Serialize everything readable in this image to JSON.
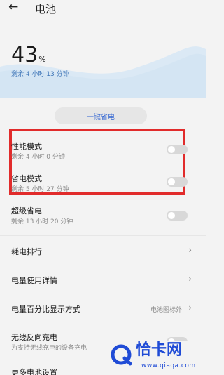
{
  "header": {
    "back_icon": "back-arrow-icon",
    "title": "电池"
  },
  "battery": {
    "percent": "43",
    "percent_sign": "%",
    "remaining": "剩余 4 小时 13 分钟",
    "level_fraction": 0.43,
    "wave_color": "#dbe9f5"
  },
  "one_key_save": "一键省电",
  "modes": [
    {
      "label": "性能模式",
      "sub": "剩余 4 小时 0 分钟"
    },
    {
      "label": "省电模式",
      "sub": "剩余 5 小时 27 分钟"
    },
    {
      "label": "超级省电",
      "sub": "剩余 13 小时 20 分钟"
    }
  ],
  "menu": {
    "ranking": "耗电排行",
    "usage_detail": "电量使用详情",
    "percent_display": "电量百分比显示方式",
    "percent_display_value": "电池图标外",
    "wireless_reverse": "无线反向充电",
    "wireless_reverse_sub": "为支持无线充电的设备充电",
    "more": "更多电池设置"
  },
  "highlight_color": "#e12b2b",
  "watermark": {
    "name": "恰卡网",
    "url": "www.qiaqa.com",
    "color": "#1f4bd6"
  }
}
